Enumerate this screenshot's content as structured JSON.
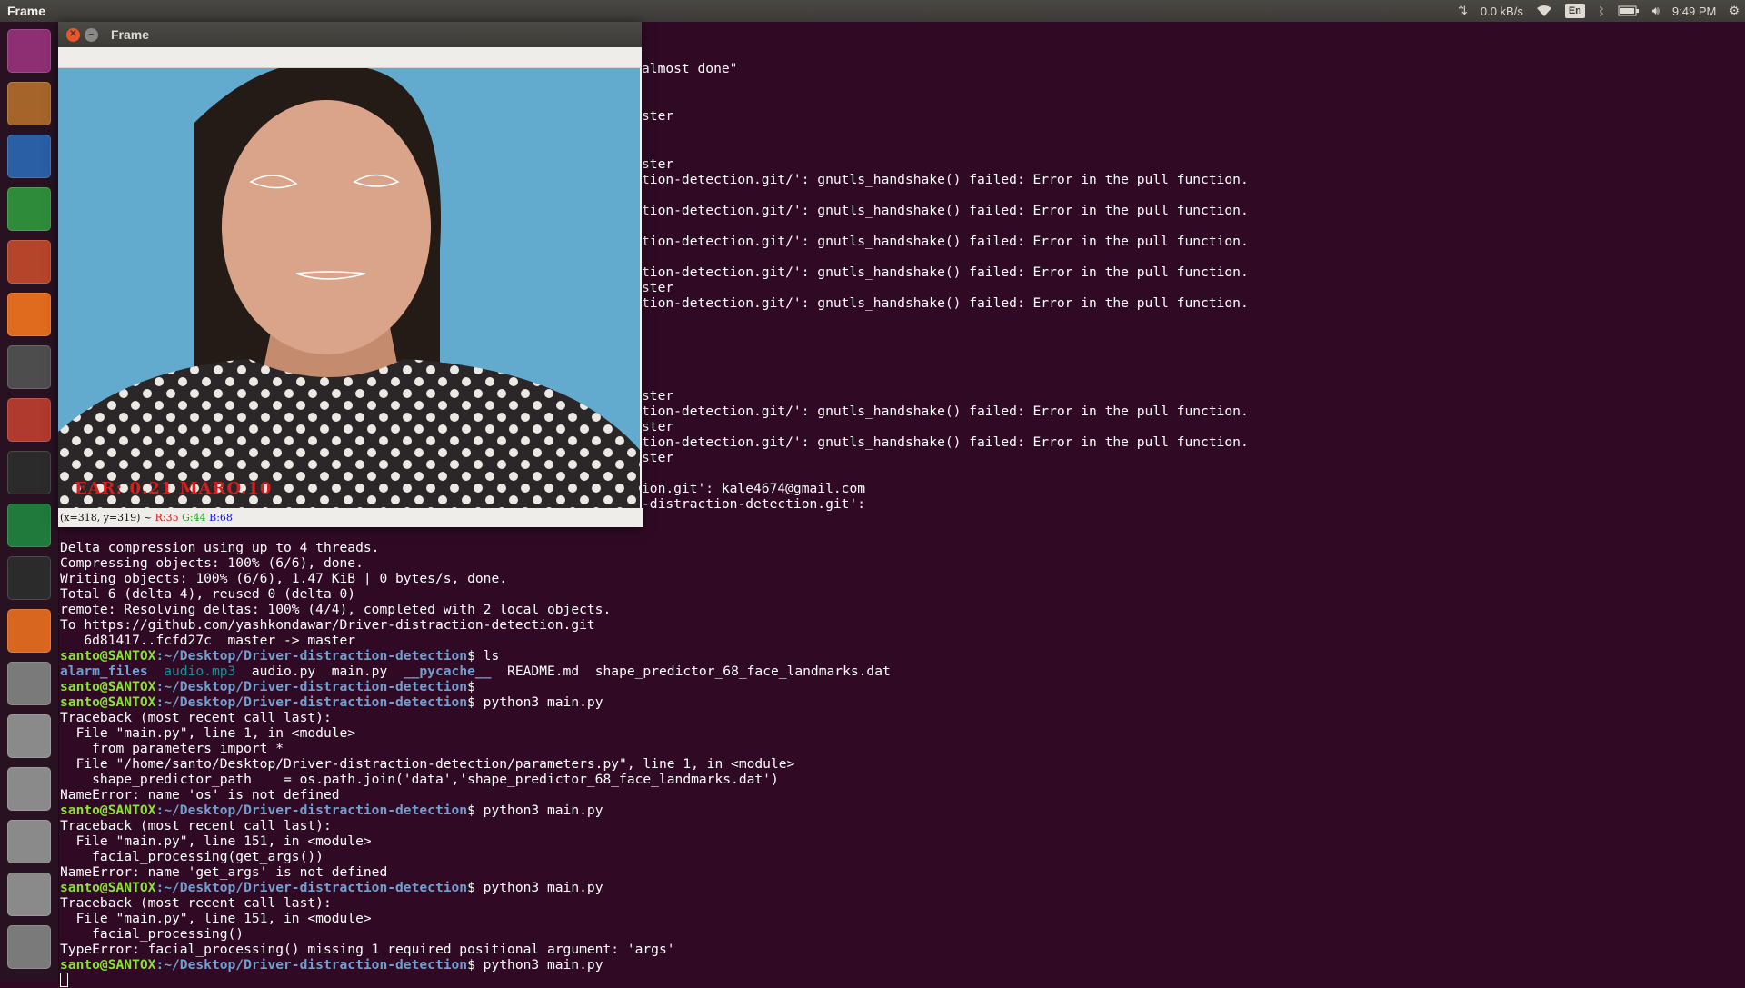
{
  "top_panel": {
    "app_title": "Frame",
    "network_speed": "0.0 kB/s",
    "keyboard_layout": "En",
    "clock": "9:49 PM"
  },
  "launcher": {
    "items": [
      {
        "name": "ubuntu-dash-icon",
        "color": "#8e2f73"
      },
      {
        "name": "files-icon",
        "color": "#a5652a"
      },
      {
        "name": "libreoffice-writer-icon",
        "color": "#2a5fa5"
      },
      {
        "name": "libreoffice-calc-icon",
        "color": "#2e8b3a"
      },
      {
        "name": "libreoffice-impress-icon",
        "color": "#b5452a"
      },
      {
        "name": "software-center-icon",
        "color": "#e06a1e"
      },
      {
        "name": "amazon-icon",
        "color": "#4d4d4d"
      },
      {
        "name": "system-settings-icon",
        "color": "#b03a2e"
      },
      {
        "name": "terminal-icon",
        "color": "#2b2b2b"
      },
      {
        "name": "pycharm-icon",
        "color": "#1f7a3c"
      },
      {
        "name": "system-monitor-icon",
        "color": "#2b2b2b"
      },
      {
        "name": "firefox-icon",
        "color": "#d9661f"
      },
      {
        "name": "help-icon",
        "color": "#7a7a7a"
      },
      {
        "name": "drive-icon",
        "color": "#8a8a8a"
      },
      {
        "name": "drive-icon",
        "color": "#8a8a8a"
      },
      {
        "name": "drive-icon",
        "color": "#8a8a8a"
      },
      {
        "name": "drive-icon",
        "color": "#8a8a8a"
      },
      {
        "name": "trash-icon",
        "color": "#7a7a7a"
      }
    ]
  },
  "frame_window": {
    "title": "Frame",
    "overlay_text": "EAR: 0.21  MARO.10",
    "status": {
      "coords": "(x=318, y=319) ~",
      "r": "R:35",
      "g": "G:44",
      "b": "B:68"
    }
  },
  "terminal": {
    "prompt_user": "santo@SANTOX",
    "prompt_path": ":~/Desktop/Driver-distraction-detection",
    "right_fragments": [
      "almost done\"",
      "ster",
      "ster",
      "tion-detection.git/': gnutls_handshake() failed: Error in the pull function.",
      "tion-detection.git/': gnutls_handshake() failed: Error in the pull function.",
      "tion-detection.git/': gnutls_handshake() failed: Error in the pull function.",
      "tion-detection.git/': gnutls_handshake() failed: Error in the pull function.",
      "ster",
      "tion-detection.git/': gnutls_handshake() failed: Error in the pull function.",
      "ster",
      "tion-detection.git/': gnutls_handshake() failed: Error in the pull function.",
      "ster",
      "tion-detection.git/': gnutls_handshake() failed: Error in the pull function.",
      "ster",
      "ion.git': kale4674@gmail.com",
      "-distraction-detection.git':"
    ],
    "lines": {
      "l1": "Delta compression using up to 4 threads.",
      "l2": "Compressing objects: 100% (6/6), done.",
      "l3": "Writing objects: 100% (6/6), 1.47 KiB | 0 bytes/s, done.",
      "l4": "Total 6 (delta 4), reused 0 (delta 0)",
      "l5": "remote: Resolving deltas: 100% (4/4), completed with 2 local objects.",
      "l6": "To https://github.com/yashkondawar/Driver-distraction-detection.git",
      "l7": "   6d81417..fcfd27c  master -> master",
      "cmd_ls": "$ ls",
      "ls_alarm": "alarm_files",
      "ls_audio_mp3": "audio.mp3",
      "ls_rest1": "  audio.py  main.py  ",
      "ls_pycache": "__pycache__",
      "ls_rest2": "  README.md  shape_predictor_68_face_landmarks.dat",
      "cmd_empty": "$",
      "cmd_run": "$ python3 main.py",
      "tb1_1": "Traceback (most recent call last):",
      "tb1_2": "  File \"main.py\", line 1, in <module>",
      "tb1_3": "    from parameters import *",
      "tb1_4": "  File \"/home/santo/Desktop/Driver-distraction-detection/parameters.py\", line 1, in <module>",
      "tb1_5": "    shape_predictor_path    = os.path.join('data','shape_predictor_68_face_landmarks.dat')",
      "tb1_6": "NameError: name 'os' is not defined",
      "tb2_1": "Traceback (most recent call last):",
      "tb2_2": "  File \"main.py\", line 151, in <module>",
      "tb2_3": "    facial_processing(get_args())",
      "tb2_4": "NameError: name 'get_args' is not defined",
      "tb3_1": "Traceback (most recent call last):",
      "tb3_2": "  File \"main.py\", line 151, in <module>",
      "tb3_3": "    facial_processing()",
      "tb3_4": "TypeError: facial_processing() missing 1 required positional argument: 'args'"
    }
  }
}
